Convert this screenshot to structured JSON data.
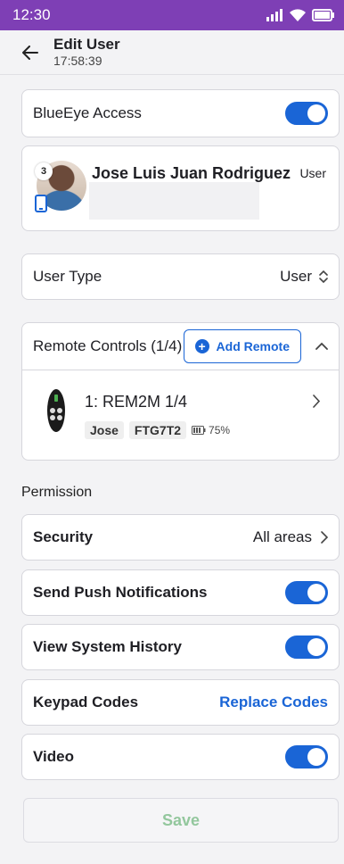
{
  "status_bar": {
    "time": "12:30",
    "icons": [
      "signal-icon",
      "wifi-icon",
      "battery-icon"
    ]
  },
  "header": {
    "title": "Edit User",
    "subtitle": "17:58:39"
  },
  "blueeye_access": {
    "label": "BlueEye Access",
    "enabled": true
  },
  "user_card": {
    "name": "Jose Luis Juan Rodriguez",
    "role": "User",
    "badge_count": "3"
  },
  "user_type": {
    "label": "User Type",
    "value": "User"
  },
  "remote_controls": {
    "title": "Remote Controls (1/4)",
    "add_label": "Add Remote",
    "items": [
      {
        "title": "1: REM2M 1/4",
        "owner": "Jose",
        "code": "FTG7T2",
        "battery": "75%"
      }
    ]
  },
  "permission": {
    "section_label": "Permission",
    "security": {
      "label": "Security",
      "value": "All areas"
    },
    "push_notifications": {
      "label": "Send Push Notifications",
      "enabled": true
    },
    "system_history": {
      "label": "View System History",
      "enabled": true
    },
    "keypad_codes": {
      "label": "Keypad Codes",
      "action": "Replace Codes"
    },
    "video": {
      "label": "Video",
      "enabled": true
    }
  },
  "footer": {
    "save_label": "Save"
  },
  "colors": {
    "status_bar": "#7e3fb5",
    "accent": "#1a65d6",
    "save_disabled_text": "#93c79d"
  }
}
